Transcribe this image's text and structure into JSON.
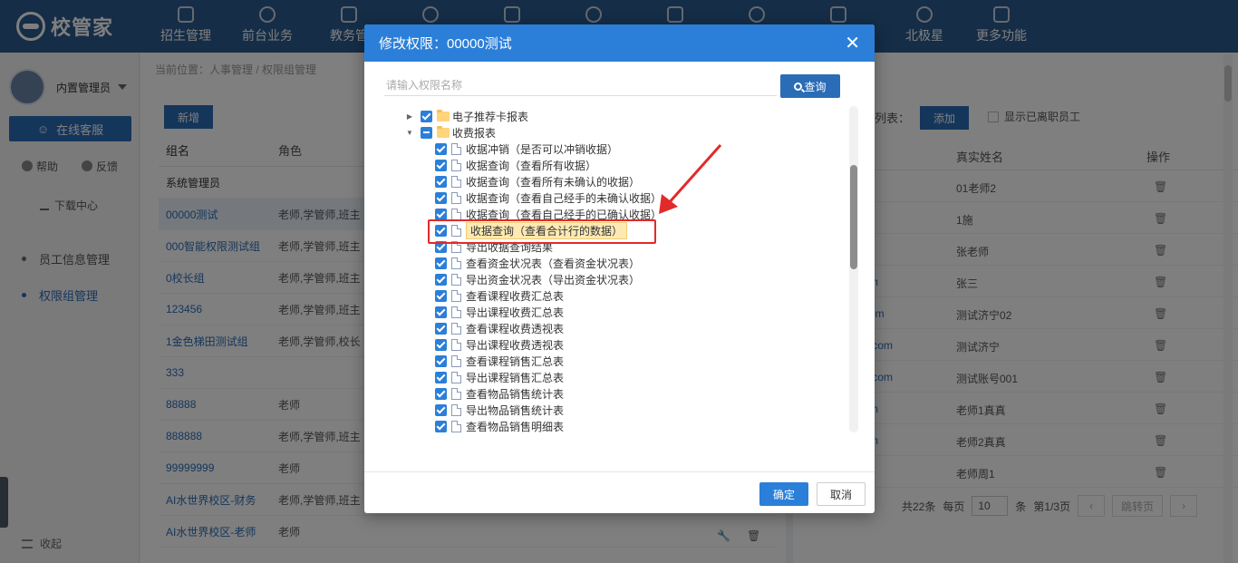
{
  "app": {
    "logo_text": "校管家"
  },
  "topnav": [
    {
      "label": "招生管理",
      "icon": "user-plus-icon"
    },
    {
      "label": "前台业务",
      "icon": "desk-icon"
    },
    {
      "label": "教务管",
      "icon": "book-icon"
    },
    {
      "label": "",
      "icon": "user-icon"
    },
    {
      "label": "",
      "icon": "login-icon"
    },
    {
      "label": "",
      "icon": "home-icon"
    },
    {
      "label": "",
      "icon": "face-icon"
    },
    {
      "label": "",
      "icon": "chart-icon"
    },
    {
      "label": "",
      "icon": "target-icon"
    },
    {
      "label": "北极星",
      "icon": "star-icon"
    },
    {
      "label": "更多功能",
      "icon": "more-icon"
    }
  ],
  "sidebar": {
    "user_name": "内置管理员",
    "service_button": "在线客服",
    "help": "帮助",
    "feedback": "反馈",
    "download": "下载中心",
    "items": [
      {
        "label": "员工信息管理"
      },
      {
        "label": "权限组管理"
      }
    ],
    "collapse": "收起"
  },
  "main": {
    "breadcrumb": "当前位置：人事管理 / 权限组管理",
    "new_button": "新增",
    "columns": {
      "group": "组名",
      "role": "角色"
    },
    "rows": [
      {
        "group": "系统管理员",
        "role": ""
      },
      {
        "group": "00000测试",
        "role": "老师,学管师,班主"
      },
      {
        "group": "000智能权限测试组",
        "role": "老师,学管师,班主"
      },
      {
        "group": "0校长组",
        "role": "老师,学管师,班主"
      },
      {
        "group": "123456",
        "role": "老师,学管师,班主"
      },
      {
        "group": "1金色梯田测试组",
        "role": "老师,学管师,校长"
      },
      {
        "group": "333",
        "role": ""
      },
      {
        "group": "88888",
        "role": "老师"
      },
      {
        "group": "888888",
        "role": "老师,学管师,班主"
      },
      {
        "group": "99999999",
        "role": "老师"
      },
      {
        "group": "AI水世界校区-财务",
        "role": "老师,学管师,班主"
      },
      {
        "group": "AI水世界校区-老师",
        "role": "老师"
      }
    ]
  },
  "right_panel": {
    "list_label": "列表：",
    "add_button": "添加",
    "show_left_label": "显示已离职员工",
    "columns": {
      "real_name": "真实姓名",
      "actions": "操作"
    },
    "rows": [
      {
        "email": "n",
        "name": "01老师2"
      },
      {
        "email": "",
        "name": "1施"
      },
      {
        "email": "",
        "name": "张老师"
      },
      {
        "email": "m",
        "name": "张三"
      },
      {
        "email": "om",
        "name": "测试济宁02"
      },
      {
        "email": ".com",
        "name": "测试济宁"
      },
      {
        "email": ".com",
        "name": "测试账号001"
      },
      {
        "email": "m",
        "name": "老师1真真"
      },
      {
        "email": "m",
        "name": "老师2真真"
      },
      {
        "email": "",
        "name": "老师周1"
      }
    ],
    "pager": {
      "total": "共22条",
      "per_page_label": "每页",
      "per_page": "10",
      "unit": "条",
      "page_info": "第1/3页",
      "prev": "‹",
      "first": "跳转页",
      "next": "›"
    }
  },
  "modal": {
    "title": "修改权限：00000测试",
    "search_placeholder": "请输入权限名称",
    "search_button": "查询",
    "tree": [
      {
        "label": "电子推荐卡报表",
        "type": "folder",
        "state": "checked",
        "level": 0,
        "expanded": false
      },
      {
        "label": "收费报表",
        "type": "folder",
        "state": "partial",
        "level": 0,
        "expanded": true
      },
      {
        "label": "收据冲销（是否可以冲销收据）",
        "type": "file",
        "state": "checked",
        "level": 1
      },
      {
        "label": "收据查询（查看所有收据）",
        "type": "file",
        "state": "checked",
        "level": 1
      },
      {
        "label": "收据查询（查看所有未确认的收据）",
        "type": "file",
        "state": "checked",
        "level": 1
      },
      {
        "label": "收据查询（查看自己经手的未确认收据）",
        "type": "file",
        "state": "checked",
        "level": 1
      },
      {
        "label": "收据查询（查看自己经手的已确认收据）",
        "type": "file",
        "state": "checked",
        "level": 1
      },
      {
        "label": "收据查询（查看合计行的数据）",
        "type": "file",
        "state": "checked",
        "level": 1,
        "highlighted": true
      },
      {
        "label": "导出收据查询结果",
        "type": "file",
        "state": "checked",
        "level": 1
      },
      {
        "label": "查看资金状况表（查看资金状况表）",
        "type": "file",
        "state": "checked",
        "level": 1
      },
      {
        "label": "导出资金状况表（导出资金状况表）",
        "type": "file",
        "state": "checked",
        "level": 1
      },
      {
        "label": "查看课程收费汇总表",
        "type": "file",
        "state": "checked",
        "level": 1
      },
      {
        "label": "导出课程收费汇总表",
        "type": "file",
        "state": "checked",
        "level": 1
      },
      {
        "label": "查看课程收费透视表",
        "type": "file",
        "state": "checked",
        "level": 1
      },
      {
        "label": "导出课程收费透视表",
        "type": "file",
        "state": "checked",
        "level": 1
      },
      {
        "label": "查看课程销售汇总表",
        "type": "file",
        "state": "checked",
        "level": 1
      },
      {
        "label": "导出课程销售汇总表",
        "type": "file",
        "state": "checked",
        "level": 1
      },
      {
        "label": "查看物品销售统计表",
        "type": "file",
        "state": "checked",
        "level": 1
      },
      {
        "label": "导出物品销售统计表",
        "type": "file",
        "state": "checked",
        "level": 1
      },
      {
        "label": "查看物品销售明细表",
        "type": "file",
        "state": "checked",
        "level": 1
      }
    ],
    "ok_button": "确定",
    "cancel_button": "取消"
  },
  "colors": {
    "brand": "#2b5a8f",
    "accent": "#2b7fd9",
    "annotation": "#e22a2a"
  }
}
